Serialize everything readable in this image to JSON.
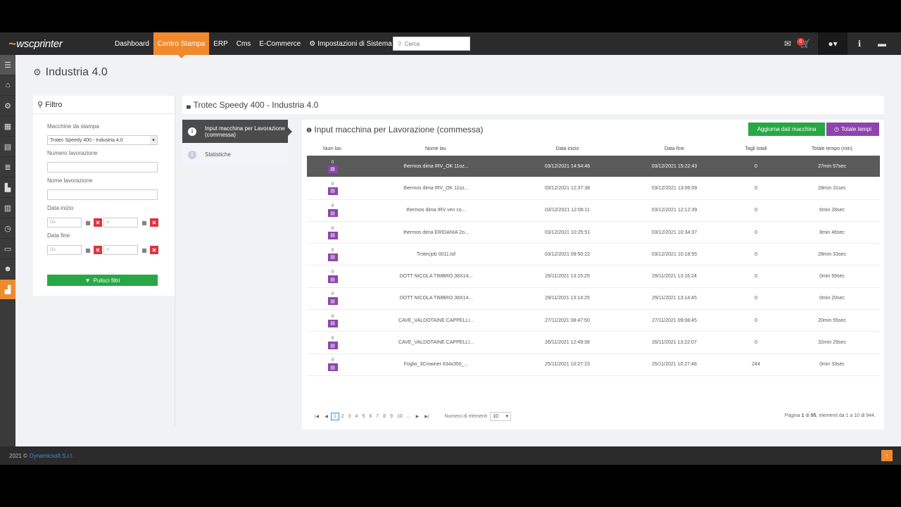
{
  "nav": {
    "brand": "wscprinter",
    "items": [
      {
        "label": "Dashboard",
        "active": false
      },
      {
        "label": "Centro Stampa",
        "active": true
      },
      {
        "label": "ERP",
        "active": false
      },
      {
        "label": "Cms",
        "active": false
      },
      {
        "label": "E-Commerce",
        "active": false
      },
      {
        "label": "Impostazioni di Sistema",
        "active": false,
        "icon": "gear-icon"
      }
    ],
    "search_placeholder": "Cerca",
    "cart_badge": "0"
  },
  "page": {
    "title": "Industria 4.0"
  },
  "filter": {
    "title": "Filtro",
    "machine_label": "Macchine da stampa",
    "machine_value": "Trotec Speedy 400 - Industria 4.0",
    "job_number_label": "Numero lavorazione",
    "job_name_label": "Nome lavorazione",
    "start_date_label": "Data inizio",
    "end_date_label": "Data fine",
    "from_placeholder": "Da",
    "to_placeholder": "A",
    "clear_button": "Pulisci filtri"
  },
  "main": {
    "title": "Trotec Speedy 400 - Industria 4.0",
    "tabs": [
      {
        "label": "Input macchina per Lavorazione (commessa)",
        "active": true
      },
      {
        "label": "Statistiche",
        "active": false
      }
    ],
    "section_title": "Input macchina per Lavorazione (commessa)",
    "refresh_button": "Aggiorna dati macchina",
    "total_button": "Totale tempi",
    "columns": [
      "Num lav.",
      "Nome lav.",
      "Data inizio",
      "Data fine",
      "Tagli totali",
      "Totale tempo (min)"
    ],
    "rows": [
      {
        "num": "0",
        "name": "thermos dima IRV_OK 11oz...",
        "start": "03/12/2021 14:54:46",
        "end": "03/12/2021 15:22:43",
        "cuts": "0",
        "time": "27min 57sec"
      },
      {
        "num": "0",
        "name": "thermos dima IRV_OK 11oz...",
        "start": "03/12/2021 12:37:38",
        "end": "03/12/2021 13:06:09",
        "cuts": "0",
        "time": "28min 31sec"
      },
      {
        "num": "0",
        "name": "thermos dima IRV ven co...",
        "start": "03/12/2021 12:06:11",
        "end": "03/12/2021 12:12:39",
        "cuts": "0",
        "time": "6min 28sec"
      },
      {
        "num": "0",
        "name": "thermos dima ERIDANIA 2o...",
        "start": "03/12/2021 10:25:51",
        "end": "03/12/2021 10:34:37",
        "cuts": "0",
        "time": "8min 46sec"
      },
      {
        "num": "0",
        "name": "Trotecjob 0011.tsf",
        "start": "03/12/2021 09:50:22",
        "end": "03/12/2021 10:18:55",
        "cuts": "0",
        "time": "28min 33sec"
      },
      {
        "num": "0",
        "name": "DOTT NICOLA TIMBRO 38X14...",
        "start": "29/11/2021 13:15:25",
        "end": "29/11/2021 13:16:24",
        "cuts": "0",
        "time": "0min 59sec"
      },
      {
        "num": "0",
        "name": "DOTT NICOLA TIMBRO 38X14...",
        "start": "29/11/2021 13:14:25",
        "end": "29/11/2021 13:14:45",
        "cuts": "0",
        "time": "0min 20sec"
      },
      {
        "num": "0",
        "name": "CAVE_VALDOTAINE CAPPELLI...",
        "start": "27/11/2021 08:47:50",
        "end": "27/11/2021 09:08:45",
        "cuts": "0",
        "time": "20min 55sec"
      },
      {
        "num": "0",
        "name": "CAVE_VALDOTAINE CAPPELLI...",
        "start": "26/11/2021 12:49:38",
        "end": "26/11/2021 13:22:07",
        "cuts": "0",
        "time": "32min 29sec"
      },
      {
        "num": "0",
        "name": "Foglio_3Crowner 634x350_...",
        "start": "25/11/2021 10:27:15",
        "end": "25/11/2021 10:27:48",
        "cuts": "244",
        "time": "0min 33sec"
      }
    ],
    "pager": {
      "pages": [
        "1",
        "2",
        "3",
        "4",
        "5",
        "6",
        "7",
        "8",
        "9",
        "10",
        "..."
      ],
      "per_page_label": "Numero di elementi",
      "per_page_value": "10",
      "info_prefix": "Pagina",
      "info_page": "1",
      "info_of": "di",
      "info_total_pages": "95",
      "info_suffix": ", elementi da 1 a 10 di 944."
    }
  },
  "footer": {
    "year": "2021 ©",
    "company": "Dynamicsoft S.r.l."
  },
  "colors": {
    "accent": "#f08a2f",
    "green": "#28a745",
    "purple": "#8e44ad",
    "red": "#d9363e"
  }
}
